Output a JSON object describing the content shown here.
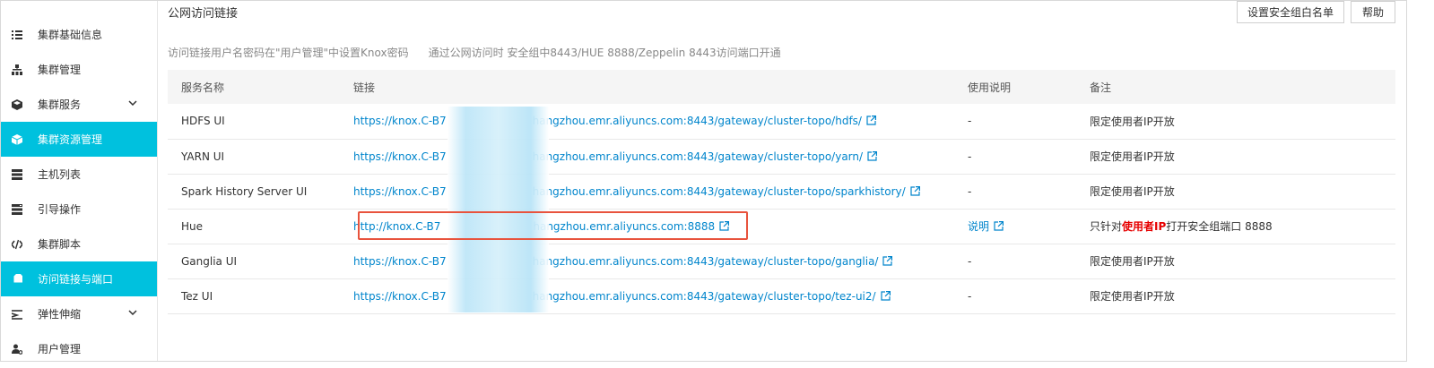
{
  "sidebar": {
    "items": [
      {
        "label": "集群基础信息",
        "icon": "list-icon"
      },
      {
        "label": "集群管理",
        "icon": "hierarchy-icon"
      },
      {
        "label": "集群服务",
        "icon": "cube-icon",
        "expandable": true
      },
      {
        "label": "集群资源管理",
        "icon": "box-icon",
        "active": true
      },
      {
        "label": "主机列表",
        "icon": "server-icon"
      },
      {
        "label": "引导操作",
        "icon": "bootstrap-icon"
      },
      {
        "label": "集群脚本",
        "icon": "code-icon"
      },
      {
        "label": "访问链接与端口",
        "icon": "tag-icon",
        "active": true
      },
      {
        "label": "弹性伸缩",
        "icon": "scale-icon",
        "expandable": true
      },
      {
        "label": "用户管理",
        "icon": "user-gear-icon"
      }
    ]
  },
  "header": {
    "title": "公网访问链接",
    "whitelist_button": "设置安全组白名单",
    "help_button": "帮助"
  },
  "notice": {
    "line1": "访问链接用户名密码在\"用户管理\"中设置Knox密码",
    "line2": "通过公网访问时 安全组中8443/HUE 8888/Zeppelin 8443访问端口开通"
  },
  "table": {
    "headers": [
      "服务名称",
      "链接",
      "使用说明",
      "备注"
    ],
    "rows": [
      {
        "name": "HDFS UI",
        "link_pre": "https://knox.C-B7",
        "link_post": "hangzhou.emr.aliyuncs.com:8443/gateway/cluster-topo/hdfs/",
        "usage": "-",
        "note": "限定使用者IP开放"
      },
      {
        "name": "YARN UI",
        "link_pre": "https://knox.C-B7",
        "link_post": "hangzhou.emr.aliyuncs.com:8443/gateway/cluster-topo/yarn/",
        "usage": "-",
        "note": "限定使用者IP开放"
      },
      {
        "name": "Spark History Server UI",
        "link_pre": "https://knox.C-B7",
        "link_post": "hangzhou.emr.aliyuncs.com:8443/gateway/cluster-topo/sparkhistory/",
        "usage": "-",
        "note": "限定使用者IP开放"
      },
      {
        "name": "Hue",
        "link_pre": "http://knox.C-B7",
        "link_post": "hangzhou.emr.aliyuncs.com:8888",
        "usage": "说明",
        "note_pre": "只针对",
        "note_strong": "使用者IP",
        "note_post": "打开安全组端口 8888"
      },
      {
        "name": "Ganglia UI",
        "link_pre": "https://knox.C-B7",
        "link_post": "hangzhou.emr.aliyuncs.com:8443/gateway/cluster-topo/ganglia/",
        "usage": "-",
        "note": "限定使用者IP开放"
      },
      {
        "name": "Tez UI",
        "link_pre": "https://knox.C-B7",
        "link_post": "hangzhou.emr.aliyuncs.com:8443/gateway/cluster-topo/tez-ui2/",
        "usage": "-",
        "note": "限定使用者IP开放"
      }
    ]
  },
  "colors": {
    "accent": "#00c1de",
    "link": "#0085cc",
    "highlight_box": "#e8533d",
    "emphasis": "#e60000"
  }
}
